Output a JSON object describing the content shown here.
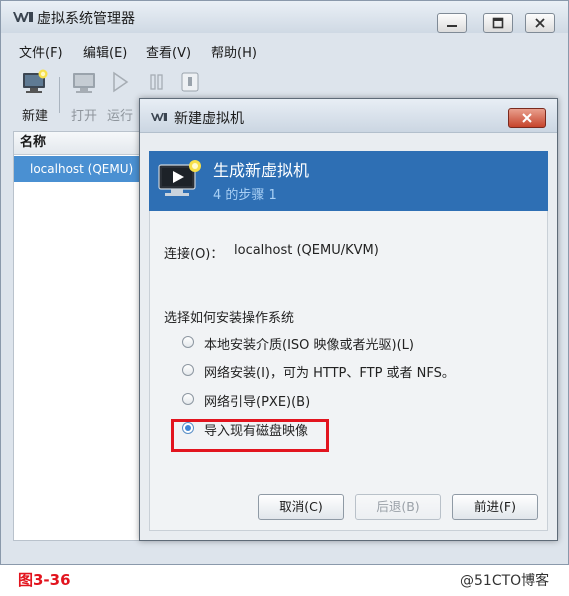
{
  "main_window": {
    "title": "虚拟系统管理器",
    "menu": [
      "文件(F)",
      "编辑(E)",
      "查看(V)",
      "帮助(H)"
    ],
    "toolbar": {
      "new": "新建",
      "open": "打开",
      "run": "运行"
    },
    "list": {
      "header": "名称",
      "rows": [
        "localhost (QEMU)"
      ]
    }
  },
  "dialog": {
    "title": "新建虚拟机",
    "banner": {
      "title": "生成新虚拟机",
      "step": "4 的步骤 1"
    },
    "connection": {
      "label": "连接(O)：",
      "value": "localhost (QEMU/KVM)"
    },
    "install_heading": "选择如何安装操作系统",
    "options": [
      {
        "label": "本地安装介质(ISO 映像或者光驱)(L)",
        "selected": false
      },
      {
        "label": "网络安装(I)，可为 HTTP、FTP 或者 NFS。",
        "selected": false
      },
      {
        "label": "网络引导(PXE)(B)",
        "selected": false
      },
      {
        "label": "导入现有磁盘映像",
        "selected": true
      }
    ],
    "buttons": {
      "cancel": "取消(C)",
      "back": "后退(B)",
      "forward": "前进(F)"
    }
  },
  "caption": "图3-36",
  "watermark": "@51CTO博客",
  "colors": {
    "banner": "#2e6fb4",
    "selection": "#4a90d2",
    "highlight": "#e2141e"
  }
}
